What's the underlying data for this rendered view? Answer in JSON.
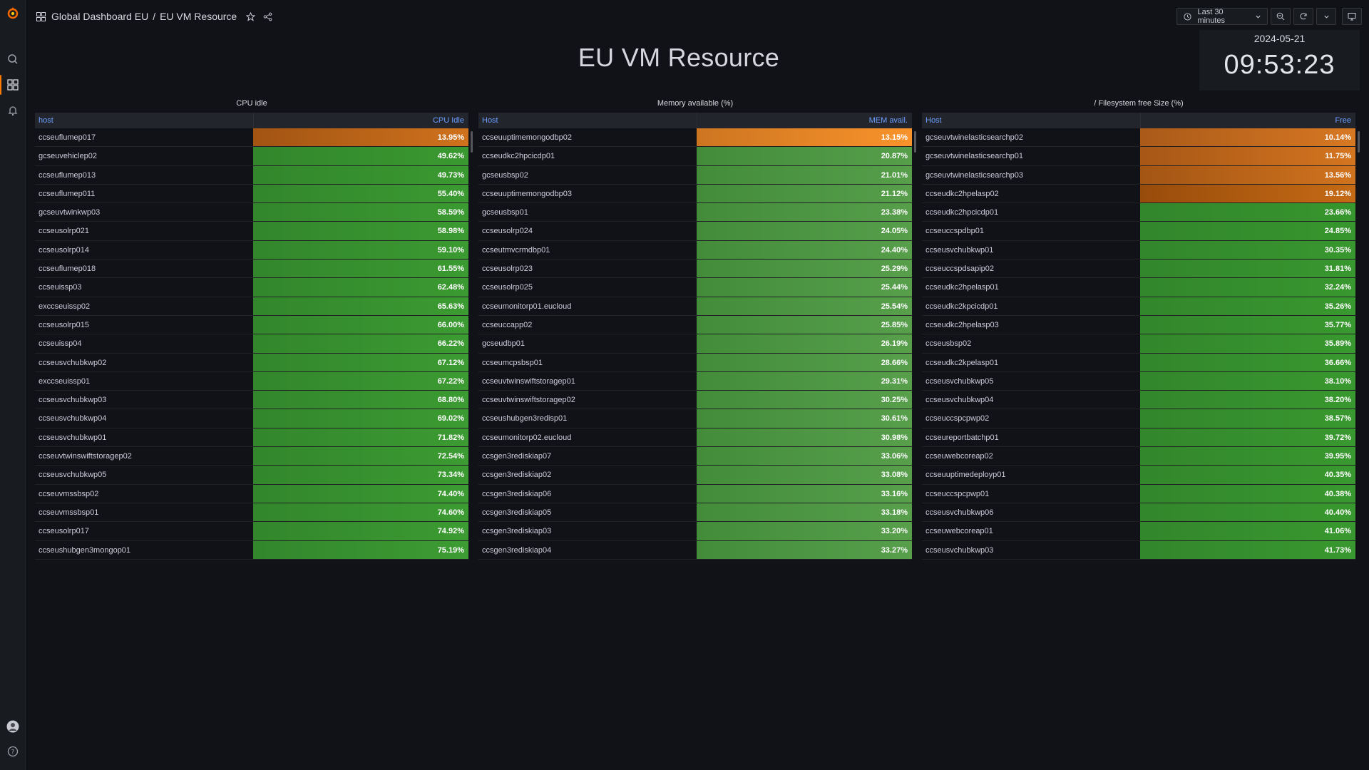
{
  "colors": {
    "bg": "#111217",
    "accent": "#ff7b00",
    "header_link": "#6e9fff",
    "good": "#37872d",
    "warn": "#ff9830"
  },
  "topbar": {
    "breadcrumb_folder": "Global Dashboard EU",
    "breadcrumb_sep": "/",
    "breadcrumb_dashboard": "EU VM Resource",
    "time_range": "Last 30 minutes"
  },
  "dashboard": {
    "title": "EU VM Resource",
    "clock_date": "2024-05-21",
    "clock_time": "09:53:23"
  },
  "panels": [
    {
      "title": "CPU idle",
      "col_host": "host",
      "col_value": "CPU Idle",
      "rows": [
        {
          "host": "ccseuflumep017",
          "value": "13.95%",
          "status": "warn"
        },
        {
          "host": "gcseuvehiclep02",
          "value": "49.62%",
          "status": "ok"
        },
        {
          "host": "ccseuflumep013",
          "value": "49.73%",
          "status": "ok"
        },
        {
          "host": "ccseuflumep011",
          "value": "55.40%",
          "status": "ok"
        },
        {
          "host": "gcseuvtwinkwp03",
          "value": "58.59%",
          "status": "ok"
        },
        {
          "host": "ccseusolrp021",
          "value": "58.98%",
          "status": "ok"
        },
        {
          "host": "ccseusolrp014",
          "value": "59.10%",
          "status": "ok"
        },
        {
          "host": "ccseuflumep018",
          "value": "61.55%",
          "status": "ok"
        },
        {
          "host": "ccseuissp03",
          "value": "62.48%",
          "status": "ok"
        },
        {
          "host": "exccseuissp02",
          "value": "65.63%",
          "status": "ok"
        },
        {
          "host": "ccseusolrp015",
          "value": "66.00%",
          "status": "ok"
        },
        {
          "host": "ccseuissp04",
          "value": "66.22%",
          "status": "ok"
        },
        {
          "host": "ccseusvchubkwp02",
          "value": "67.12%",
          "status": "ok"
        },
        {
          "host": "exccseuissp01",
          "value": "67.22%",
          "status": "ok"
        },
        {
          "host": "ccseusvchubkwp03",
          "value": "68.80%",
          "status": "ok"
        },
        {
          "host": "ccseusvchubkwp04",
          "value": "69.02%",
          "status": "ok"
        },
        {
          "host": "ccseusvchubkwp01",
          "value": "71.82%",
          "status": "ok"
        },
        {
          "host": "ccseuvtwinswiftstoragep02",
          "value": "72.54%",
          "status": "ok"
        },
        {
          "host": "ccseusvchubkwp05",
          "value": "73.34%",
          "status": "ok"
        },
        {
          "host": "ccseuvmssbsp02",
          "value": "74.40%",
          "status": "ok"
        },
        {
          "host": "ccseuvmssbsp01",
          "value": "74.60%",
          "status": "ok"
        },
        {
          "host": "ccseusolrp017",
          "value": "74.92%",
          "status": "ok"
        },
        {
          "host": "ccseushubgen3mongop01",
          "value": "75.19%",
          "status": "ok"
        }
      ]
    },
    {
      "title": "Memory available (%)",
      "col_host": "Host",
      "col_value": "MEM avail.",
      "rows": [
        {
          "host": "ccseuuptimemongodbp02",
          "value": "13.15%",
          "status": "warn"
        },
        {
          "host": "ccseudkc2hpcicdp01",
          "value": "20.87%",
          "status": "ok"
        },
        {
          "host": "gcseusbsp02",
          "value": "21.01%",
          "status": "ok"
        },
        {
          "host": "ccseuuptimemongodbp03",
          "value": "21.12%",
          "status": "ok"
        },
        {
          "host": "gcseusbsp01",
          "value": "23.38%",
          "status": "ok"
        },
        {
          "host": "ccseusolrp024",
          "value": "24.05%",
          "status": "ok"
        },
        {
          "host": "ccseutmvcrmdbp01",
          "value": "24.40%",
          "status": "ok"
        },
        {
          "host": "ccseusolrp023",
          "value": "25.29%",
          "status": "ok"
        },
        {
          "host": "ccseusolrp025",
          "value": "25.44%",
          "status": "ok"
        },
        {
          "host": "ccseumonitorp01.eucloud",
          "value": "25.54%",
          "status": "ok"
        },
        {
          "host": "ccseuccapp02",
          "value": "25.85%",
          "status": "ok"
        },
        {
          "host": "gcseudbp01",
          "value": "26.19%",
          "status": "ok"
        },
        {
          "host": "ccseumcpsbsp01",
          "value": "28.66%",
          "status": "ok"
        },
        {
          "host": "ccseuvtwinswiftstoragep01",
          "value": "29.31%",
          "status": "ok"
        },
        {
          "host": "ccseuvtwinswiftstoragep02",
          "value": "30.25%",
          "status": "ok"
        },
        {
          "host": "ccseushubgen3redisp01",
          "value": "30.61%",
          "status": "ok"
        },
        {
          "host": "ccseumonitorp02.eucloud",
          "value": "30.98%",
          "status": "ok"
        },
        {
          "host": "ccsgen3rediskiap07",
          "value": "33.06%",
          "status": "ok"
        },
        {
          "host": "ccsgen3rediskiap02",
          "value": "33.08%",
          "status": "ok"
        },
        {
          "host": "ccsgen3rediskiap06",
          "value": "33.16%",
          "status": "ok"
        },
        {
          "host": "ccsgen3rediskiap05",
          "value": "33.18%",
          "status": "ok"
        },
        {
          "host": "ccsgen3rediskiap03",
          "value": "33.20%",
          "status": "ok"
        },
        {
          "host": "ccsgen3rediskiap04",
          "value": "33.27%",
          "status": "ok"
        }
      ]
    },
    {
      "title": "/ Filesystem free Size (%)",
      "col_host": "Host",
      "col_value": "Free",
      "rows": [
        {
          "host": "gcseuvtwinelasticsearchp02",
          "value": "10.14%",
          "status": "warn"
        },
        {
          "host": "gcseuvtwinelasticsearchp01",
          "value": "11.75%",
          "status": "warn"
        },
        {
          "host": "gcseuvtwinelasticsearchp03",
          "value": "13.56%",
          "status": "warn"
        },
        {
          "host": "ccseudkc2hpelasp02",
          "value": "19.12%",
          "status": "warn"
        },
        {
          "host": "ccseudkc2hpcicdp01",
          "value": "23.66%",
          "status": "ok"
        },
        {
          "host": "ccseuccspdbp01",
          "value": "24.85%",
          "status": "ok"
        },
        {
          "host": "ccseusvchubkwp01",
          "value": "30.35%",
          "status": "ok"
        },
        {
          "host": "ccseuccspdsapip02",
          "value": "31.81%",
          "status": "ok"
        },
        {
          "host": "ccseudkc2hpelasp01",
          "value": "32.24%",
          "status": "ok"
        },
        {
          "host": "ccseudkc2kpcicdp01",
          "value": "35.26%",
          "status": "ok"
        },
        {
          "host": "ccseudkc2hpelasp03",
          "value": "35.77%",
          "status": "ok"
        },
        {
          "host": "ccseusbsp02",
          "value": "35.89%",
          "status": "ok"
        },
        {
          "host": "ccseudkc2kpelasp01",
          "value": "36.66%",
          "status": "ok"
        },
        {
          "host": "ccseusvchubkwp05",
          "value": "38.10%",
          "status": "ok"
        },
        {
          "host": "ccseusvchubkwp04",
          "value": "38.20%",
          "status": "ok"
        },
        {
          "host": "ccseuccspcpwp02",
          "value": "38.57%",
          "status": "ok"
        },
        {
          "host": "ccseureportbatchp01",
          "value": "39.72%",
          "status": "ok"
        },
        {
          "host": "ccseuwebcoreap02",
          "value": "39.95%",
          "status": "ok"
        },
        {
          "host": "ccseuuptimedeployp01",
          "value": "40.35%",
          "status": "ok"
        },
        {
          "host": "ccseuccspcpwp01",
          "value": "40.38%",
          "status": "ok"
        },
        {
          "host": "ccseusvchubkwp06",
          "value": "40.40%",
          "status": "ok"
        },
        {
          "host": "ccseuwebcoreap01",
          "value": "41.06%",
          "status": "ok"
        },
        {
          "host": "ccseusvchubkwp03",
          "value": "41.73%",
          "status": "ok"
        }
      ]
    }
  ]
}
